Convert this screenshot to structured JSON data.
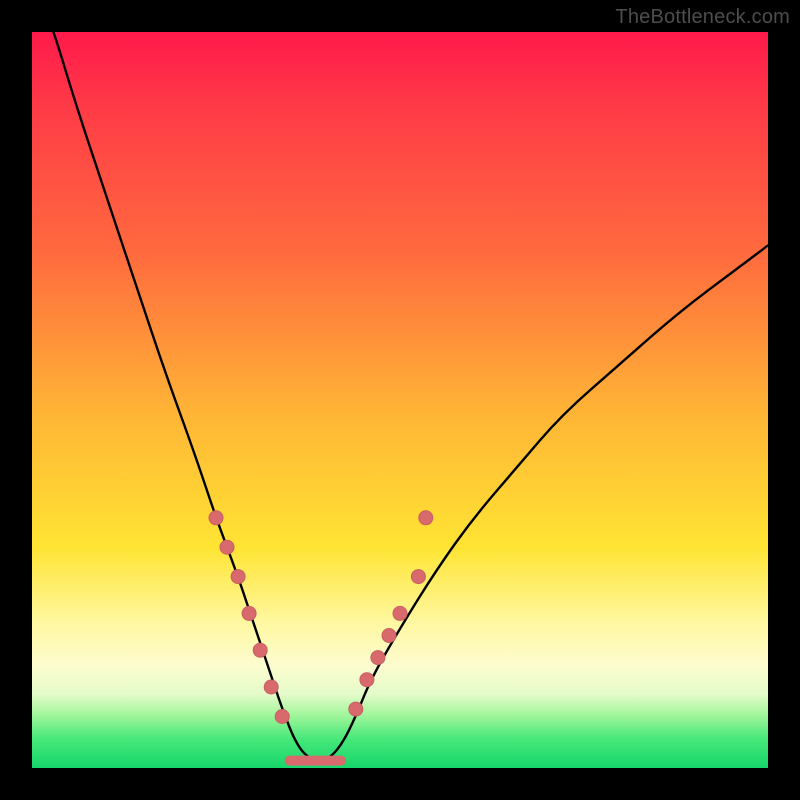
{
  "watermark": "TheBottleneck.com",
  "colors": {
    "curve_stroke": "#000000",
    "marker_fill": "#d86a6d",
    "marker_stroke": "#c95e60",
    "flat_segment": "#d86a6d"
  },
  "chart_data": {
    "type": "line",
    "title": "",
    "xlabel": "",
    "ylabel": "",
    "xlim": [
      0,
      100
    ],
    "ylim": [
      0,
      100
    ],
    "grid": false,
    "legend": false,
    "series": [
      {
        "name": "bottleneck-curve",
        "description": "V-shaped bottleneck curve; y≈100 at edges, y≈0 near x≈37 with a short flat minimum segment",
        "x": [
          0,
          3,
          6,
          10,
          14,
          18,
          22,
          25,
          28,
          30,
          32,
          34,
          36,
          38,
          40,
          42,
          44,
          46,
          50,
          55,
          60,
          66,
          72,
          80,
          88,
          96,
          100
        ],
        "y": [
          108,
          100,
          90,
          78,
          66,
          54,
          43,
          34,
          26,
          20,
          14,
          8,
          3,
          1,
          1,
          3,
          7,
          12,
          19,
          27,
          34,
          41,
          48,
          55,
          62,
          68,
          71
        ]
      }
    ],
    "markers": {
      "description": "Highlighted sample points clustered near the minimum on both sides, plus a flat pink segment at the trough",
      "left_side": [
        {
          "x": 25.0,
          "y": 34
        },
        {
          "x": 26.5,
          "y": 30
        },
        {
          "x": 28.0,
          "y": 26
        },
        {
          "x": 29.5,
          "y": 21
        },
        {
          "x": 31.0,
          "y": 16
        },
        {
          "x": 32.5,
          "y": 11
        },
        {
          "x": 34.0,
          "y": 7
        }
      ],
      "right_side": [
        {
          "x": 44.0,
          "y": 8
        },
        {
          "x": 45.5,
          "y": 12
        },
        {
          "x": 47.0,
          "y": 15
        },
        {
          "x": 48.5,
          "y": 18
        },
        {
          "x": 50.0,
          "y": 21
        },
        {
          "x": 52.5,
          "y": 26
        },
        {
          "x": 53.5,
          "y": 34
        }
      ],
      "flat_segment": {
        "x_start": 35,
        "x_end": 42,
        "y": 1
      }
    }
  }
}
